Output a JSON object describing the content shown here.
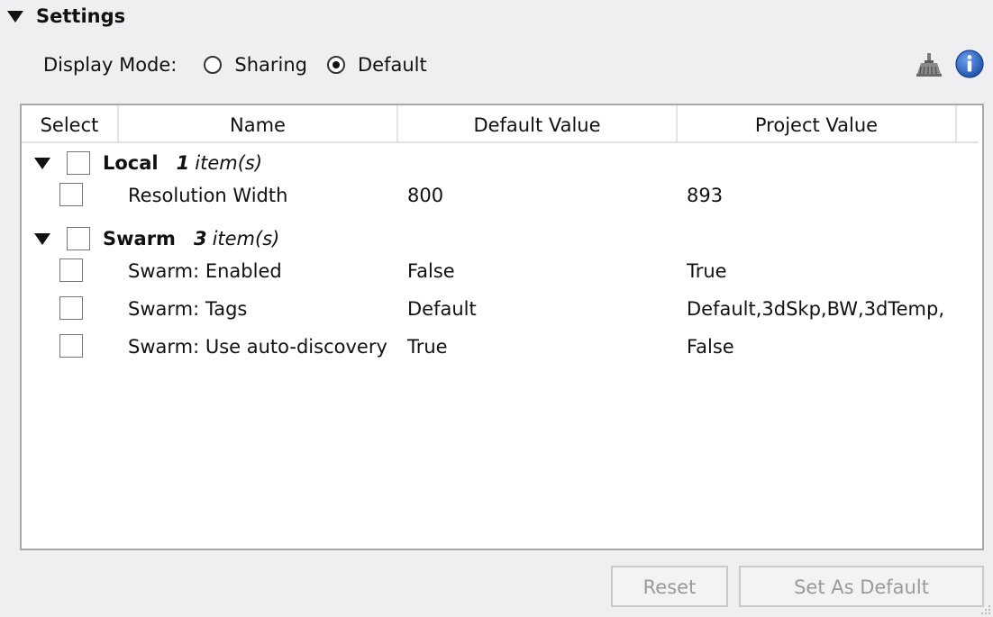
{
  "section": {
    "title": "Settings"
  },
  "display_mode": {
    "label": "Display Mode:",
    "options": [
      {
        "label": "Sharing",
        "selected": false
      },
      {
        "label": "Default",
        "selected": true
      }
    ]
  },
  "toolbar": {
    "icons": [
      "sweep-broom-icon",
      "info-icon"
    ]
  },
  "table": {
    "columns": [
      "Select",
      "Name",
      "Default Value",
      "Project Value"
    ],
    "groups": [
      {
        "name": "Local",
        "count": "1",
        "count_label": "item(s)",
        "rows": [
          {
            "name": "Resolution Width",
            "default_value": "800",
            "project_value": "893"
          }
        ]
      },
      {
        "name": "Swarm",
        "count": "3",
        "count_label": "item(s)",
        "rows": [
          {
            "name": "Swarm: Enabled",
            "default_value": "False",
            "project_value": "True"
          },
          {
            "name": "Swarm: Tags",
            "default_value": "Default",
            "project_value": "Default,3dSkp,BW,3dTemp,"
          },
          {
            "name": "Swarm: Use auto-discovery",
            "default_value": "True",
            "project_value": "False"
          }
        ]
      }
    ]
  },
  "buttons": {
    "reset": "Reset",
    "set_as_default": "Set As Default"
  },
  "colors": {
    "info_blue": "#1e56b0",
    "disabled_text": "#9a9a9a"
  }
}
